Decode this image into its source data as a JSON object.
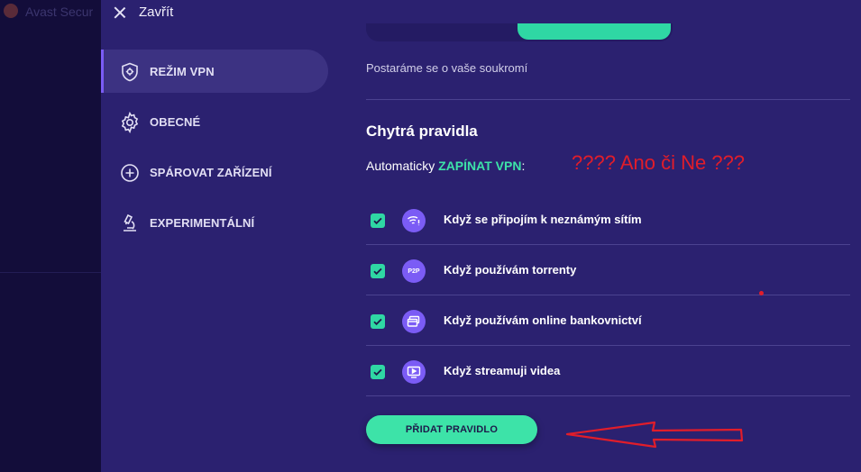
{
  "background_app": {
    "title": "Avast Secur"
  },
  "topbar": {
    "close_label": "Zavřít"
  },
  "sidebar": {
    "items": [
      {
        "label": "REŽIM VPN",
        "icon": "shield-gear-icon",
        "active": true
      },
      {
        "label": "OBECNÉ",
        "icon": "gear-icon",
        "active": false
      },
      {
        "label": "SPÁROVAT ZAŘÍZENÍ",
        "icon": "plus-circle-icon",
        "active": false
      },
      {
        "label": "EXPERIMENTÁLNÍ",
        "icon": "microscope-icon",
        "active": false
      }
    ]
  },
  "main": {
    "privacy_text": "Postaráme se o vaše soukromí",
    "heading": "Chytrá pravidla",
    "auto_prefix": "Automaticky ",
    "auto_accent": "ZAPÍNAT VPN",
    "auto_suffix": ":",
    "rules": [
      {
        "label": "Když se připojím k neznámým sítím",
        "icon": "wifi-warning-icon",
        "checked": true
      },
      {
        "label": "Když používám torrenty",
        "icon": "p2p-icon",
        "icon_text": "P2P",
        "checked": true
      },
      {
        "label": "Když používám online bankovnictví",
        "icon": "bank-card-icon",
        "checked": true
      },
      {
        "label": "Když streamuji videa",
        "icon": "video-play-icon",
        "checked": true
      }
    ],
    "add_button_label": "PŘIDAT PRAVIDLO"
  },
  "annotation": {
    "text": "???? Ano či Ne ???"
  },
  "colors": {
    "panel": "#2b2170",
    "accent_green": "#3de3a8",
    "accent_purple": "#7b5cf5",
    "annotation_red": "#e11d2a"
  }
}
